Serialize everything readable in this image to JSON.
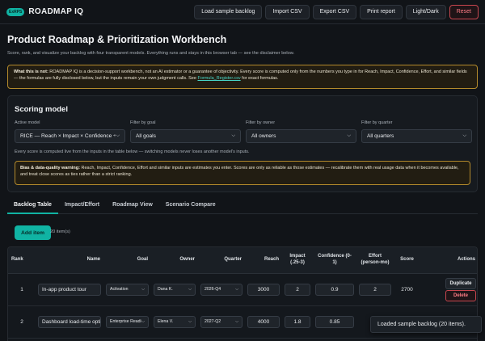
{
  "app": {
    "badge": "ExRPS",
    "brand": "ROADMAP IQ",
    "buttons": [
      "Load sample backlog",
      "Import CSV",
      "Export CSV",
      "Print report",
      "Light/Dark",
      "Reset"
    ]
  },
  "page": {
    "title": "Product Roadmap & Prioritization Workbench",
    "subtitle": "Score, rank, and visualize your backlog with four transparent models. Everything runs and stays in this browser tab — see the disclaimer below."
  },
  "notice": {
    "bold": "What this is not:",
    "text": " ROADMAP IQ is a decision-support workbench, not an AI estimator or a guarantee of objectivity. Every score is computed only from the numbers you type in for Reach, Impact, Confidence, Effort, and similar fields — the formulas are fully disclosed below, but the inputs remain your own judgment calls. See ",
    "link": "Formula_Register.csv",
    "tail": " for exact formulas."
  },
  "scoring": {
    "heading": "Scoring model",
    "filters": [
      {
        "label": "Active model",
        "value": "RICE — Reach × Impact × Confidence ÷ Effort"
      },
      {
        "label": "Filter by goal",
        "value": "All goals"
      },
      {
        "label": "Filter by owner",
        "value": "All owners"
      },
      {
        "label": "Filter by quarter",
        "value": "All quarters"
      }
    ],
    "help": "Every score is computed live from the inputs in the table below — switching models never loses another model's inputs.",
    "warning_bold": "Bias & data-quality warning:",
    "warning_text": " Reach, Impact, Confidence, Effort and similar inputs are estimates you enter. Scores are only as reliable as those estimates — recalibrate them with real usage data when it becomes available, and treat close scores as ties rather than a strict ranking."
  },
  "tabs": [
    "Backlog Table",
    "Impact/Effort",
    "Roadmap View",
    "Scenario Compare"
  ],
  "active_tab": 0,
  "backlog": {
    "add_label": "Add item",
    "count": "20 item(s)",
    "columns": [
      "Rank",
      "Name",
      "Goal",
      "Owner",
      "Quarter",
      "Reach",
      "Impact (.25-3)",
      "Confidence (0-1)",
      "Effort (person-mo)",
      "Score",
      "Actions"
    ],
    "rows": [
      {
        "rank": "1",
        "name": "In-app product tour",
        "goal": "Activation",
        "owner": "Dana K.",
        "quarter": "2026-Q4",
        "reach": "3000",
        "impact": "2",
        "confidence": "0.9",
        "effort": "2",
        "score": "2700"
      },
      {
        "rank": "2",
        "name": "Dashboard load-time optimization",
        "goal": "Enterprise Readiness",
        "owner": "Elena V.",
        "quarter": "2027-Q2",
        "reach": "4000",
        "impact": "1.8",
        "confidence": "0.85",
        "effort": "",
        "score": ""
      }
    ],
    "duplicate_label": "Duplicate",
    "delete_label": "Delete"
  },
  "toast": "Loaded sample backlog (20 items)."
}
